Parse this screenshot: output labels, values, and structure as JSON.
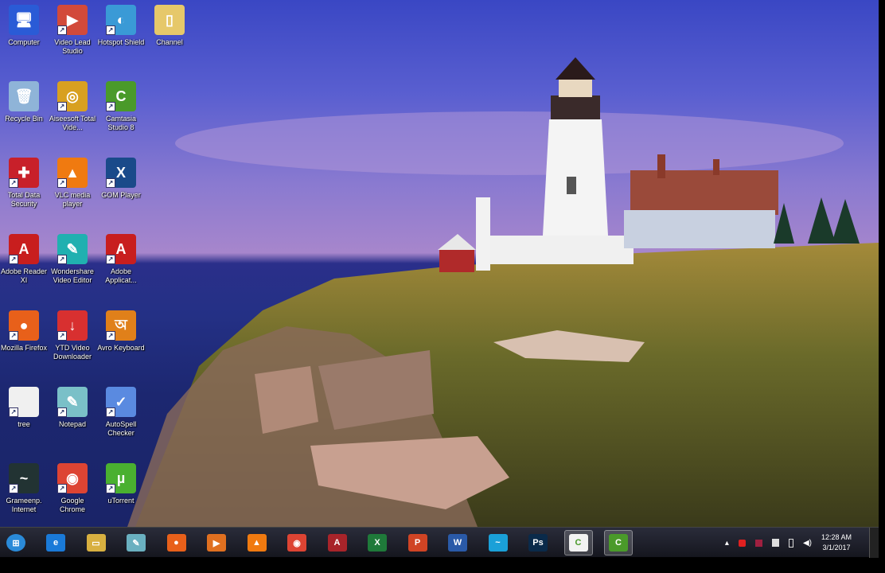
{
  "desktop_icons": [
    {
      "label": "Computer",
      "color": "#2a5bd6",
      "glyph": "🖥"
    },
    {
      "label": "Video Lead Studio",
      "color": "#d24a3a",
      "glyph": "▶"
    },
    {
      "label": "Hotspot Shield",
      "color": "#3a9ad6",
      "glyph": "◐"
    },
    {
      "label": "Channel",
      "color": "#e6c86a",
      "glyph": "▯"
    },
    {
      "label": "Recycle Bin",
      "color": "#8fb4d8",
      "glyph": "🗑"
    },
    {
      "label": "Aiseesoft Total Vide...",
      "color": "#d8a020",
      "glyph": "◎"
    },
    {
      "label": "Camtasia Studio 8",
      "color": "#4a9a2a",
      "glyph": "C"
    },
    {
      "label": "Total Data Security",
      "color": "#c8202a",
      "glyph": "✚"
    },
    {
      "label": "VLC media player",
      "color": "#f07a10",
      "glyph": "▲"
    },
    {
      "label": "GOM Player",
      "color": "#1a4a8a",
      "glyph": "X"
    },
    {
      "label": "Adobe Reader XI",
      "color": "#c81e1e",
      "glyph": "A"
    },
    {
      "label": "Wondershare Video Editor",
      "color": "#20b0b0",
      "glyph": "✎"
    },
    {
      "label": "Adobe Applicat...",
      "color": "#c81e1e",
      "glyph": "A"
    },
    {
      "label": "Mozilla Firefox",
      "color": "#e8601a",
      "glyph": "●"
    },
    {
      "label": "YTD Video Downloader",
      "color": "#d83030",
      "glyph": "↓"
    },
    {
      "label": "Avro Keyboard",
      "color": "#e0801a",
      "glyph": "অ"
    },
    {
      "label": "tree",
      "color": "#f0f0f0",
      "glyph": ""
    },
    {
      "label": "Notepad",
      "color": "#7ac0c8",
      "glyph": "✎"
    },
    {
      "label": "AutoSpell Checker",
      "color": "#5a8ae0",
      "glyph": "✓"
    },
    {
      "label": "Grameenp. Internet",
      "color": "#233",
      "glyph": "~"
    },
    {
      "label": "Google Chrome",
      "color": "#dd4433",
      "glyph": "◉"
    },
    {
      "label": "uTorrent",
      "color": "#4ab030",
      "glyph": "µ"
    }
  ],
  "taskbar": {
    "start": {
      "glyph": "⊞",
      "color": "#2a8ad8"
    },
    "items": [
      {
        "name": "internet-explorer",
        "glyph": "e",
        "color": "#1a7ad8"
      },
      {
        "name": "file-explorer",
        "glyph": "▭",
        "color": "#d8b040"
      },
      {
        "name": "notepad",
        "glyph": "✎",
        "color": "#6ab0c0"
      },
      {
        "name": "firefox",
        "glyph": "●",
        "color": "#e8601a"
      },
      {
        "name": "media-player",
        "glyph": "▶",
        "color": "#e07020"
      },
      {
        "name": "vlc",
        "glyph": "▲",
        "color": "#f07a10"
      },
      {
        "name": "chrome",
        "glyph": "◉",
        "color": "#dd4433"
      },
      {
        "name": "access",
        "glyph": "A",
        "color": "#a8242a"
      },
      {
        "name": "excel",
        "glyph": "X",
        "color": "#1f7a3a"
      },
      {
        "name": "powerpoint",
        "glyph": "P",
        "color": "#d04424"
      },
      {
        "name": "word",
        "glyph": "W",
        "color": "#2a5aa8"
      },
      {
        "name": "grameenphone",
        "glyph": "~",
        "color": "#1aa0d8"
      },
      {
        "name": "photoshop",
        "glyph": "Ps",
        "color": "#0a2a4a"
      },
      {
        "name": "camtasia-recorder",
        "glyph": "C",
        "color": "#f2f2f2"
      },
      {
        "name": "camtasia-studio",
        "glyph": "C",
        "color": "#4a9a2a"
      }
    ]
  },
  "tray": {
    "time": "12:28 AM",
    "date": "3/1/2017",
    "show_hidden": "▴"
  }
}
